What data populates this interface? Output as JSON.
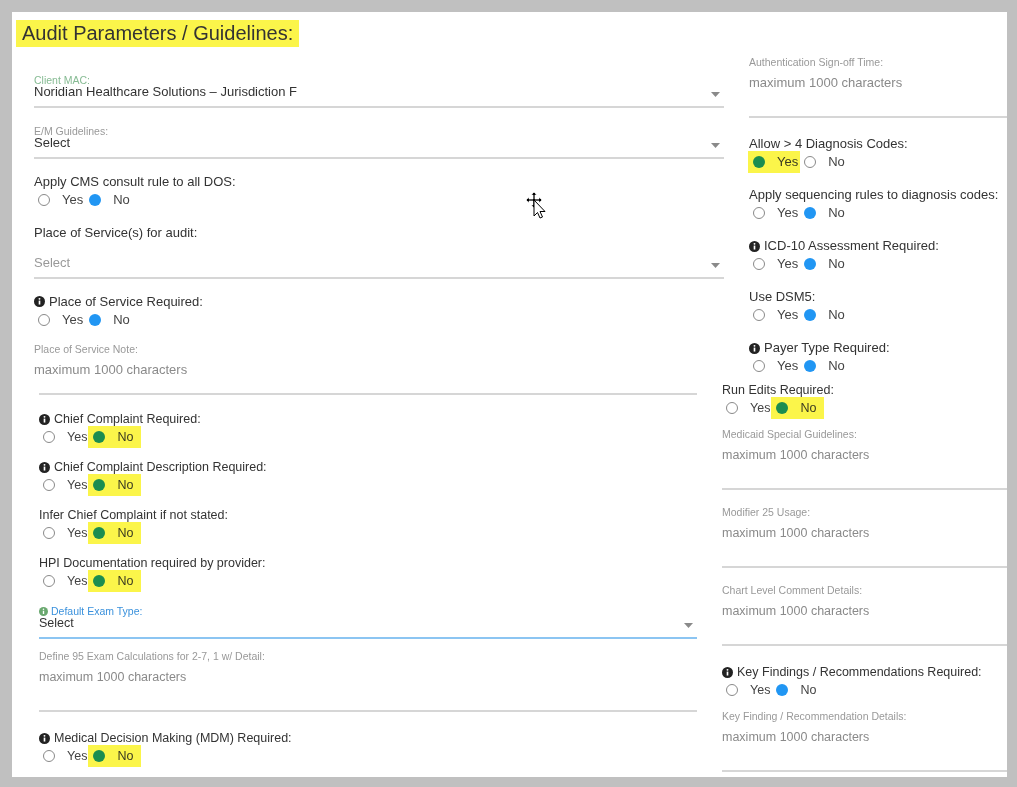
{
  "title": {
    "text": "Audit Parameters / Guidelines:",
    "highlighted": true
  },
  "panels": [
    {
      "left": [
        {
          "kind": "select",
          "label": "Client MAC:",
          "valid": true,
          "focused": false,
          "info": false,
          "value": "Noridian Healthcare Solutions – Jurisdiction F"
        },
        {
          "kind": "select",
          "label": "E/M Guidelines:",
          "valid": false,
          "focused": false,
          "info": false,
          "value": "Select"
        },
        {
          "kind": "radio",
          "label": "Apply CMS consult rule to all DOS:",
          "info": false,
          "highlighted": false,
          "options": [
            {
              "label": "Yes",
              "selected": false
            },
            {
              "label": "No",
              "selected": true
            }
          ]
        },
        {
          "kind": "heading",
          "text": "Place of Service(s) for audit:"
        },
        {
          "kind": "select",
          "focused": false,
          "placeholder": "Select"
        },
        {
          "kind": "radio",
          "label": "Place of Service Required:",
          "info": true,
          "highlighted": false,
          "options": [
            {
              "label": "Yes",
              "selected": false
            },
            {
              "label": "No",
              "selected": true
            }
          ]
        },
        {
          "kind": "textarea",
          "label": "Place of Service Note:",
          "placeholder": "maximum 1000 characters",
          "underline": false
        }
      ],
      "right": [
        {
          "kind": "textarea",
          "label": "Authentication Sign-off Time:",
          "placeholder": "maximum 1000 characters",
          "underline": true
        },
        {
          "kind": "radio",
          "label": "Allow > 4 Diagnosis Codes:",
          "info": false,
          "highlighted": true,
          "options": [
            {
              "label": "Yes",
              "selected": true
            },
            {
              "label": "No",
              "selected": false
            }
          ]
        },
        {
          "kind": "radio",
          "label": "Apply sequencing rules to diagnosis codes:",
          "info": false,
          "highlighted": false,
          "options": [
            {
              "label": "Yes",
              "selected": false
            },
            {
              "label": "No",
              "selected": true
            }
          ]
        },
        {
          "kind": "radio",
          "label": "ICD-10 Assessment Required:",
          "info": true,
          "highlighted": false,
          "options": [
            {
              "label": "Yes",
              "selected": false
            },
            {
              "label": "No",
              "selected": true
            }
          ]
        },
        {
          "kind": "radio",
          "label": "Use DSM5:",
          "info": false,
          "highlighted": false,
          "options": [
            {
              "label": "Yes",
              "selected": false
            },
            {
              "label": "No",
              "selected": true
            }
          ]
        },
        {
          "kind": "radio",
          "label": "Payer Type Required:",
          "info": true,
          "highlighted": false,
          "options": [
            {
              "label": "Yes",
              "selected": false
            },
            {
              "label": "No",
              "selected": true
            }
          ]
        }
      ]
    },
    {
      "left": [
        {
          "kind": "rule"
        },
        {
          "kind": "radio",
          "label": "Chief Complaint Required:",
          "info": true,
          "highlighted": true,
          "options": [
            {
              "label": "Yes",
              "selected": false
            },
            {
              "label": "No",
              "selected": true
            }
          ]
        },
        {
          "kind": "radio",
          "label": "Chief Complaint Description Required:",
          "info": true,
          "highlighted": true,
          "options": [
            {
              "label": "Yes",
              "selected": false
            },
            {
              "label": "No",
              "selected": true
            }
          ]
        },
        {
          "kind": "radio",
          "label": "Infer Chief Complaint if not stated:",
          "info": false,
          "highlighted": true,
          "options": [
            {
              "label": "Yes",
              "selected": false
            },
            {
              "label": "No",
              "selected": true
            }
          ]
        },
        {
          "kind": "radio",
          "label": "HPI Documentation required by provider:",
          "info": false,
          "highlighted": true,
          "options": [
            {
              "label": "Yes",
              "selected": false
            },
            {
              "label": "No",
              "selected": true
            }
          ]
        },
        {
          "kind": "select",
          "label": "Default Exam Type:",
          "valid": false,
          "focused": true,
          "info": true,
          "value": "Select"
        },
        {
          "kind": "textarea",
          "label": "Define 95 Exam Calculations for 2-7, 1 w/ Detail:",
          "placeholder": "maximum 1000 characters",
          "underline": true
        },
        {
          "kind": "radio",
          "label": "Medical Decision Making (MDM) Required:",
          "info": true,
          "highlighted": true,
          "options": [
            {
              "label": "Yes",
              "selected": false
            },
            {
              "label": "No",
              "selected": true
            }
          ]
        }
      ],
      "right": [
        {
          "kind": "radio",
          "label": "Run Edits Required:",
          "info": false,
          "highlighted": true,
          "options": [
            {
              "label": "Yes",
              "selected": false
            },
            {
              "label": "No",
              "selected": true
            }
          ]
        },
        {
          "kind": "textarea",
          "label": "Medicaid Special Guidelines:",
          "placeholder": "maximum 1000 characters",
          "underline": true
        },
        {
          "kind": "textarea",
          "label": "Modifier 25 Usage:",
          "placeholder": "maximum 1000 characters",
          "underline": true
        },
        {
          "kind": "textarea",
          "label": "Chart Level Comment Details:",
          "placeholder": "maximum 1000 characters",
          "underline": true
        },
        {
          "kind": "radio",
          "label": "Key Findings / Recommendations Required:",
          "info": true,
          "highlighted": false,
          "options": [
            {
              "label": "Yes",
              "selected": false
            },
            {
              "label": "No",
              "selected": true
            }
          ]
        },
        {
          "kind": "textarea",
          "label": "Key Finding / Recommendation Details:",
          "placeholder": "maximum 1000 characters",
          "underline": true
        }
      ]
    }
  ]
}
